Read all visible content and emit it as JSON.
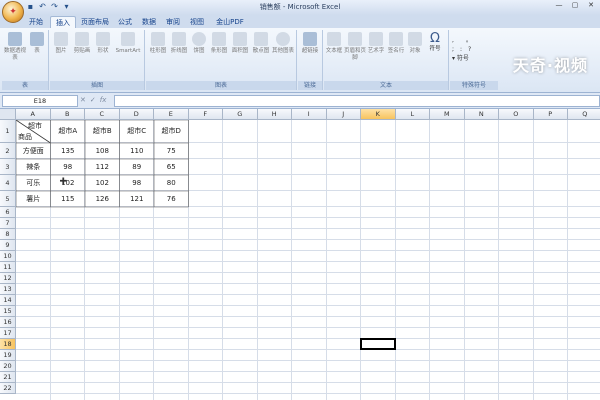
{
  "window": {
    "title": "销售额 - Microsoft Excel",
    "watermark": "天奇·视频"
  },
  "tabs": [
    {
      "label": "开始"
    },
    {
      "label": "插入",
      "active": true
    },
    {
      "label": "页面布局"
    },
    {
      "label": "公式"
    },
    {
      "label": "数据"
    },
    {
      "label": "审阅"
    },
    {
      "label": "视图"
    },
    {
      "label": "金山PDF"
    }
  ],
  "ribbon": {
    "groups": [
      {
        "label": "表",
        "buttons": [
          "数据透视表",
          "表"
        ]
      },
      {
        "label": "插图",
        "buttons": [
          "图片",
          "剪贴画",
          "形状",
          "SmartArt"
        ]
      },
      {
        "label": "图表",
        "buttons": [
          "柱形图",
          "折线图",
          "饼图",
          "条形图",
          "面积图",
          "散点图",
          "其他图表"
        ]
      },
      {
        "label": "链接",
        "buttons": [
          "超链接"
        ]
      },
      {
        "label": "文本",
        "buttons": [
          "文本框",
          "页眉和页脚",
          "艺术字",
          "签名行",
          "对象",
          "符号"
        ]
      },
      {
        "label": "特殊符号",
        "buttons": [
          "符号"
        ]
      }
    ]
  },
  "formula_bar": {
    "name_box": "E18",
    "fx": "fx",
    "formula": ""
  },
  "sheet": {
    "columns": [
      "A",
      "B",
      "C",
      "D",
      "E",
      "F",
      "G",
      "H",
      "I",
      "J",
      "K",
      "L",
      "M",
      "N",
      "O",
      "P",
      "Q"
    ],
    "selected_column": "K",
    "selected_row": "18",
    "row_count": 22,
    "header_a1_top": "超市",
    "header_a1_bottom": "商品",
    "col_headers": [
      "超市A",
      "超市B",
      "超市C",
      "超市D"
    ],
    "rows": [
      {
        "item": "方便面",
        "values": [
          "135",
          "108",
          "110",
          "75"
        ]
      },
      {
        "item": "辣条",
        "values": [
          "98",
          "112",
          "89",
          "65"
        ]
      },
      {
        "item": "可乐",
        "values": [
          "102",
          "102",
          "98",
          "80"
        ]
      },
      {
        "item": "薯片",
        "values": [
          "115",
          "126",
          "121",
          "76"
        ]
      }
    ]
  }
}
